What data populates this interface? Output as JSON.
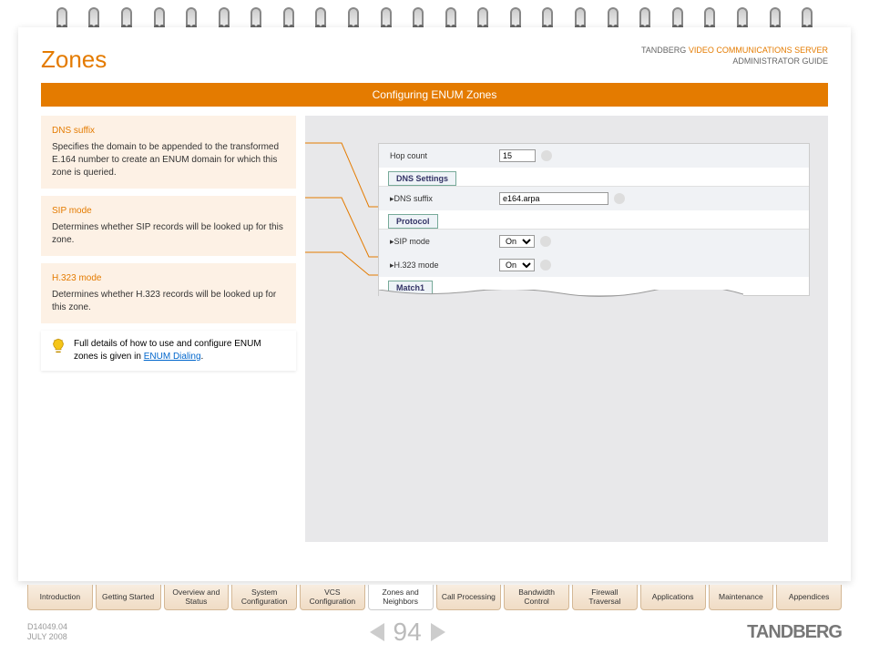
{
  "header": {
    "title": "Zones",
    "company": "TANDBERG",
    "product": "VIDEO COMMUNICATIONS SERVER",
    "subtitle": "ADMINISTRATOR GUIDE"
  },
  "banner": "Configuring ENUM Zones",
  "sidebar": {
    "items": [
      {
        "title": "DNS suffix",
        "text": "Specifies the domain to be appended to the transformed E.164 number to create an ENUM domain for which this zone is queried."
      },
      {
        "title": "SIP mode",
        "text": "Determines whether SIP records will be looked up for this zone."
      },
      {
        "title": "H.323 mode",
        "text": "Determines whether H.323 records will be looked up for this zone."
      }
    ],
    "tip": {
      "prefix": "Full details of how to use and configure ENUM zones is given in ",
      "link": "ENUM Dialing",
      "suffix": "."
    }
  },
  "form": {
    "hop_count": {
      "label": "Hop count",
      "value": "15"
    },
    "sections": {
      "dns": "DNS Settings",
      "protocol": "Protocol",
      "match": "Match1"
    },
    "dns_suffix": {
      "label": "DNS suffix",
      "value": "e164.arpa"
    },
    "sip_mode": {
      "label": "SIP mode",
      "value": "On"
    },
    "h323_mode": {
      "label": "H.323 mode",
      "value": "On"
    }
  },
  "tabs": [
    "Introduction",
    "Getting Started",
    "Overview and Status",
    "System Configuration",
    "VCS Configuration",
    "Zones and Neighbors",
    "Call Processing",
    "Bandwidth Control",
    "Firewall Traversal",
    "Applications",
    "Maintenance",
    "Appendices"
  ],
  "footer": {
    "doc_id": "D14049.04",
    "date": "JULY 2008",
    "page": "94",
    "brand": "TANDBERG"
  }
}
